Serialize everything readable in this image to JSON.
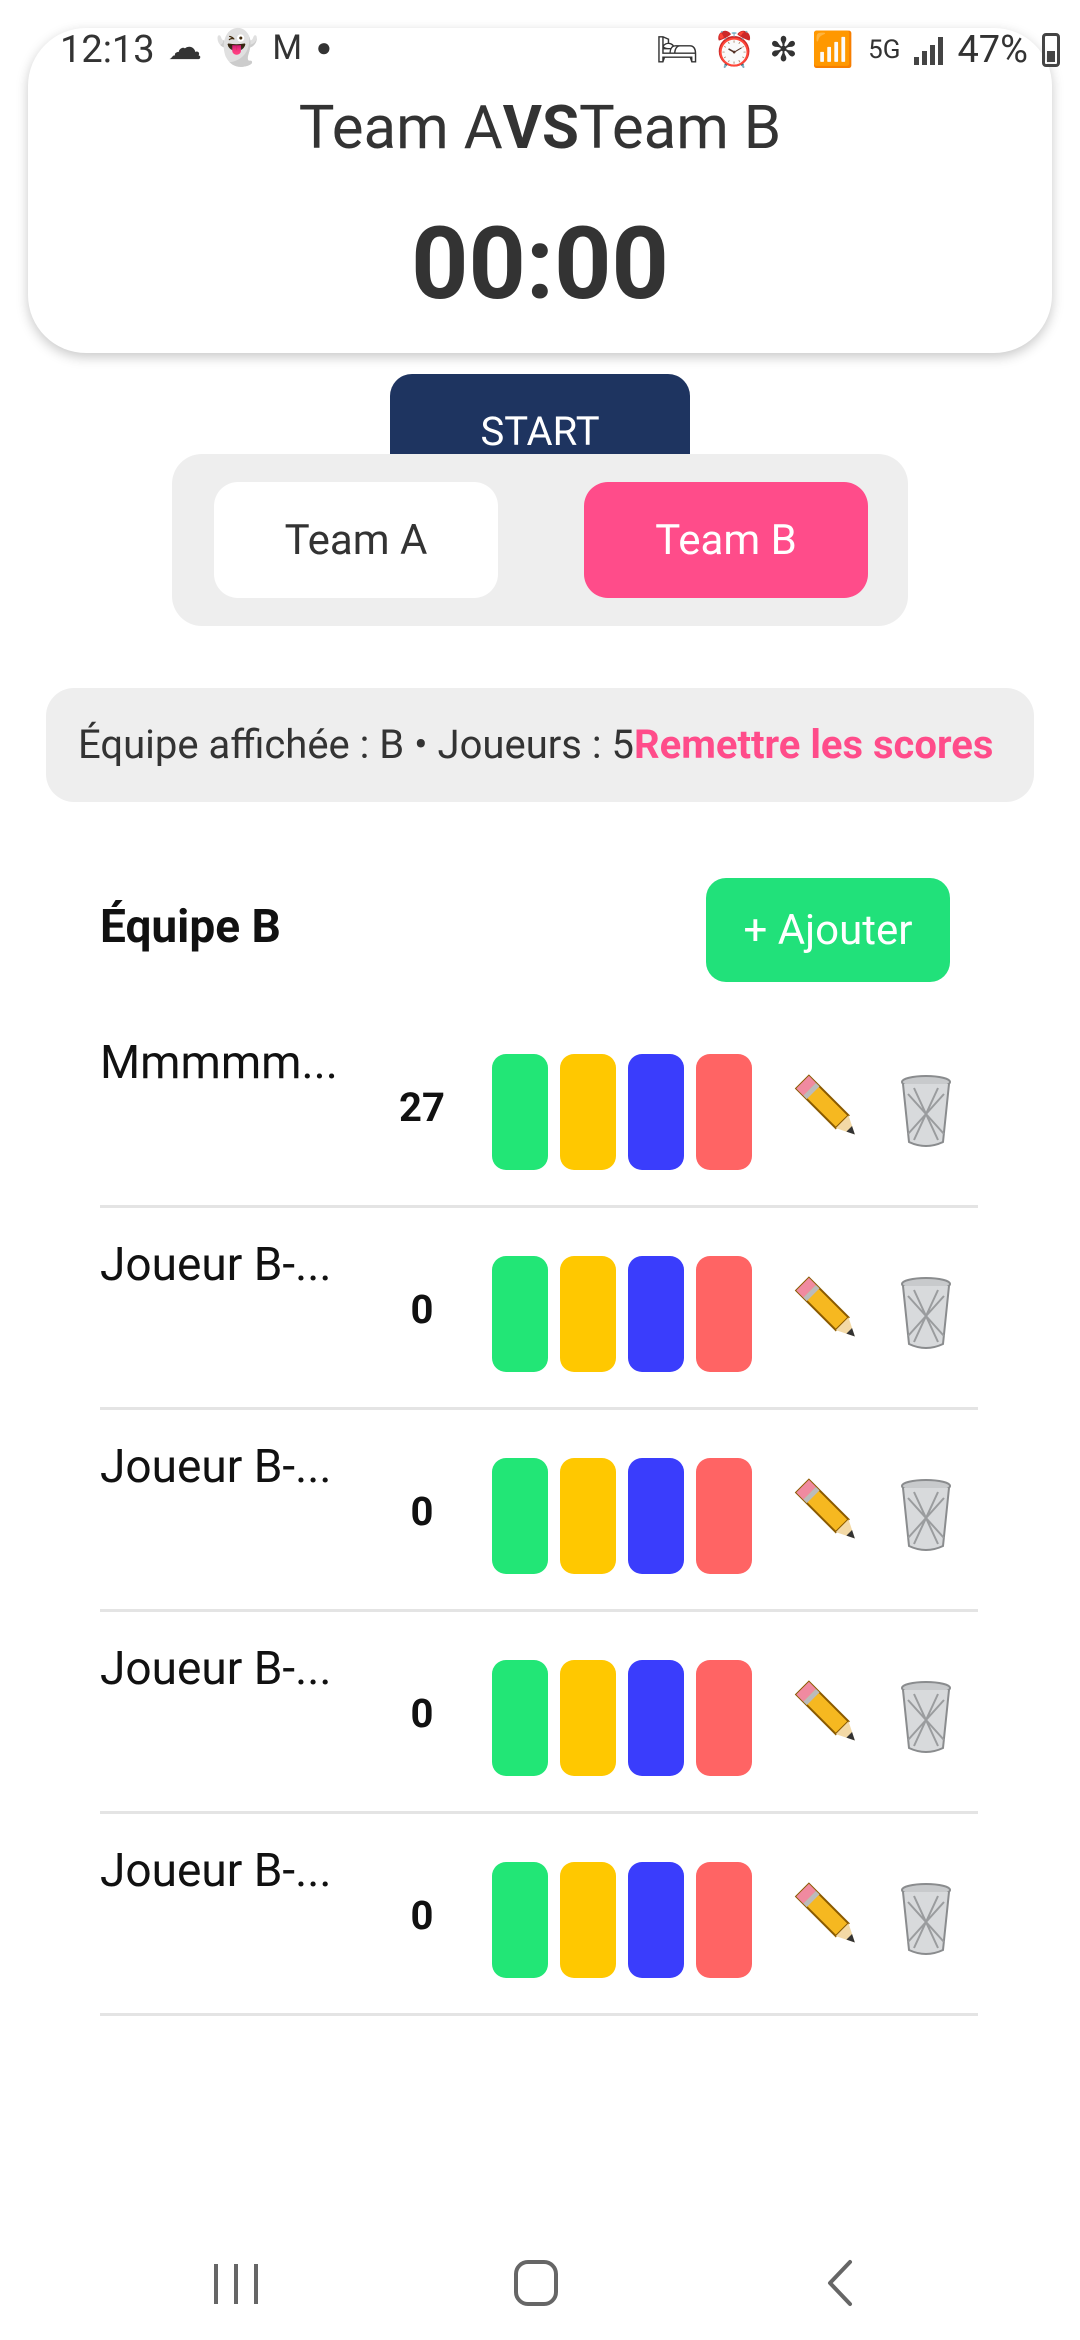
{
  "status_bar": {
    "time": "12:13",
    "battery": "47%",
    "left_icons": [
      "cloud-icon",
      "snapchat-icon",
      "gmail-icon",
      "dot-icon"
    ],
    "right_icons": [
      "bed-icon",
      "alarm-icon",
      "bluetooth-icon",
      "wifi-icon",
      "volte-5g-icon",
      "signal-icon",
      "battery-icon"
    ]
  },
  "header": {
    "team_a": "Team A",
    "vs": "VS",
    "team_b": "Team B",
    "timer": "00:00"
  },
  "controls": {
    "start_label": "START"
  },
  "team_switch": {
    "tab_a": "Team A",
    "tab_b": "Team B",
    "selected": "Team B"
  },
  "info_bar": {
    "text": "Équipe affichée : B • Joueurs : 5",
    "reset_label": "Remettre les scores"
  },
  "team_section": {
    "title": "Équipe B",
    "add_label": "+ Ajouter"
  },
  "players": [
    {
      "name": "Mmmmm...",
      "score": "27"
    },
    {
      "name": "Joueur B-...",
      "score": "0"
    },
    {
      "name": "Joueur B-...",
      "score": "0"
    },
    {
      "name": "Joueur B-...",
      "score": "0"
    },
    {
      "name": "Joueur B-...",
      "score": "0"
    }
  ],
  "colors": {
    "accent_pink": "#ff4c8a",
    "start_navy": "#1e3460",
    "add_green": "#21e17a",
    "btn_green": "#22e676",
    "btn_yellow": "#ffc800",
    "btn_blue": "#3a3dfc",
    "btn_red": "#ff6464"
  }
}
